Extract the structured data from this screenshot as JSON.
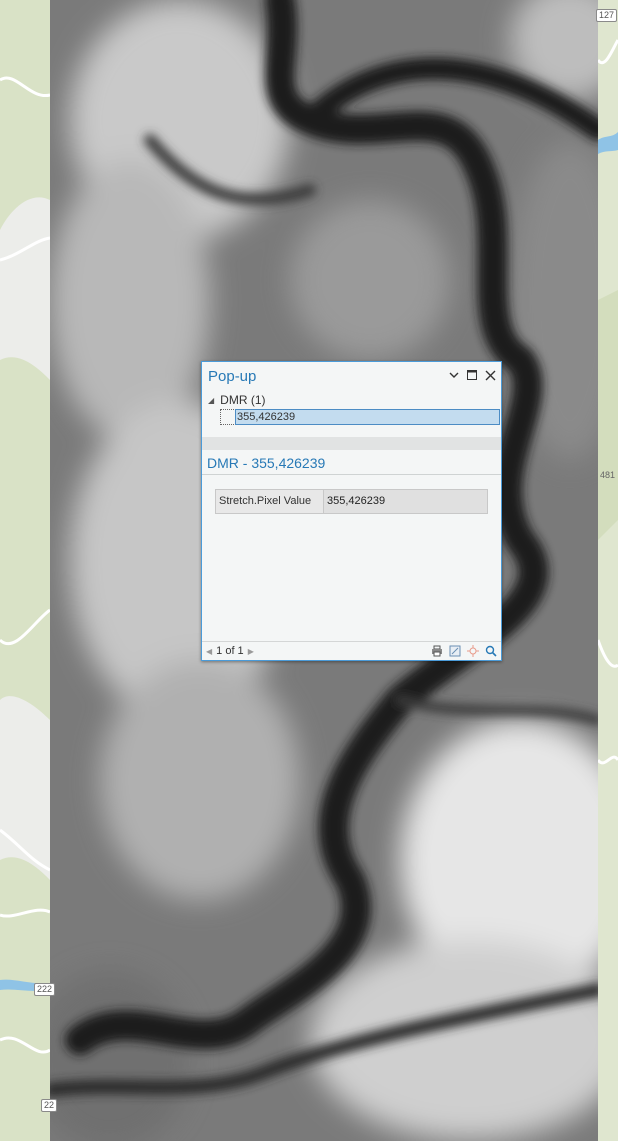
{
  "map": {
    "road_shields": [
      "127",
      "222",
      "22"
    ],
    "road_label": "481",
    "colors": {
      "basemap_green": "#d9e2c6",
      "basemap_light": "#ececea",
      "road_white": "#ffffff",
      "water": "#8fc3e6"
    }
  },
  "popup": {
    "title": "Pop-up",
    "icons": [
      "chevron-down-icon",
      "maximize-icon",
      "close-icon"
    ],
    "layer_label": "DMR (1)",
    "feature_label": "355,426239",
    "feature_title": "DMR - 355,426239",
    "attributes": [
      {
        "name": "Stretch.Pixel Value",
        "value": "355,426239"
      }
    ],
    "pager_text": "1 of 1",
    "footer_tools": [
      "print-icon",
      "export-icon",
      "flash-icon",
      "zoom-to-icon"
    ],
    "accent_color": "#2779b6"
  }
}
